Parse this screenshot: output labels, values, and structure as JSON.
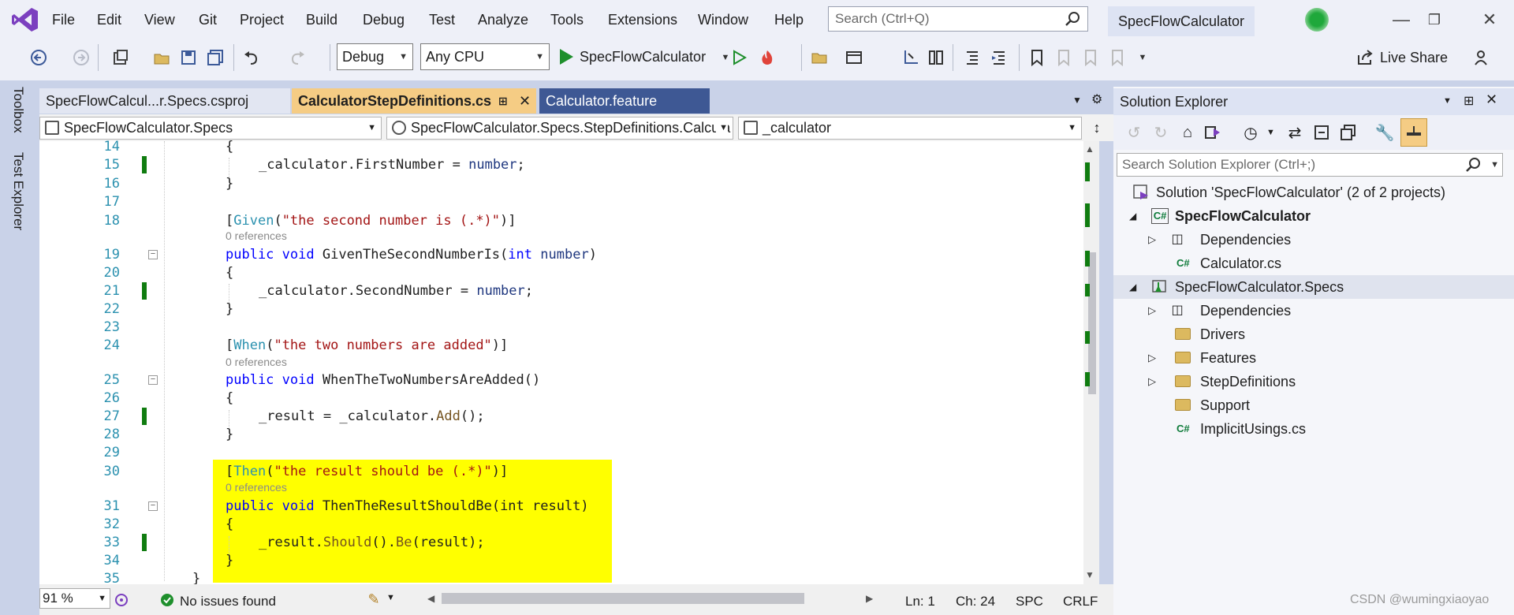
{
  "menu": [
    "File",
    "Edit",
    "View",
    "Git",
    "Project",
    "Build",
    "Debug",
    "Test",
    "Analyze",
    "Tools",
    "Extensions",
    "Window",
    "Help"
  ],
  "search": {
    "placeholder": "Search (Ctrl+Q)"
  },
  "project_title": "SpecFlowCalculator",
  "toolbar": {
    "config": "Debug",
    "platform": "Any CPU",
    "start_label": "SpecFlowCalculator",
    "live_share": "Live Share"
  },
  "left_rail": {
    "toolbox": "Toolbox",
    "test_explorer": "Test Explorer"
  },
  "tabs": [
    {
      "label": "SpecFlowCalcul...r.Specs.csproj"
    },
    {
      "label": "CalculatorStepDefinitions.cs"
    },
    {
      "label": "Calculator.feature"
    }
  ],
  "navbar": {
    "project": "SpecFlowCalculator.Specs",
    "class": "SpecFlowCalculator.Specs.StepDefinitions.Calcula",
    "member": "_calculator"
  },
  "code": {
    "l14": "{",
    "l15a": "_calculator.FirstNumber = ",
    "l15b": "number",
    ";": ";",
    "l18_attr": "Given",
    "l18_str": "\"the second number is (.*)\"",
    "refs": "0 references",
    "l19_name": "GivenTheSecondNumberIs",
    "l19_type": "int",
    "l19_param": "number",
    "l21a": "_calculator.SecondNumber = ",
    "l21b": "number",
    "l24_attr": "When",
    "l24_str": "\"the two numbers are added\"",
    "l25_name": "WhenTheTwoNumbersAreAdded",
    "l27a": "_result = _calculator.",
    "l27b": "Add",
    "l30_attr": "Then",
    "l30_str": "\"the result should be (.*)\"",
    "l31_name": "ThenTheResultShouldBe",
    "l31_param": "int result",
    "l33a": "_result.",
    "l33b": "Should",
    "l33c": "().",
    "l33d": "Be",
    "l33e": "(result);",
    "public": "public",
    "void": "void"
  },
  "line_numbers": [
    "14",
    "15",
    "16",
    "17",
    "18",
    "19",
    "20",
    "21",
    "22",
    "23",
    "24",
    "25",
    "26",
    "27",
    "28",
    "29",
    "30",
    "31",
    "32",
    "33",
    "34",
    "35"
  ],
  "status": {
    "zoom": "91 %",
    "issues": "No issues found",
    "ln": "Ln: 1",
    "ch": "Ch: 24",
    "spc": "SPC",
    "crlf": "CRLF"
  },
  "solution_explorer": {
    "title": "Solution Explorer",
    "search_placeholder": "Search Solution Explorer (Ctrl+;)",
    "items": [
      {
        "label": "Solution 'SpecFlowCalculator' (2 of 2 projects)"
      },
      {
        "label": "SpecFlowCalculator"
      },
      {
        "label": "Dependencies"
      },
      {
        "label": "Calculator.cs"
      },
      {
        "label": "SpecFlowCalculator.Specs"
      },
      {
        "label": "Dependencies"
      },
      {
        "label": "Drivers"
      },
      {
        "label": "Features"
      },
      {
        "label": "StepDefinitions"
      },
      {
        "label": "Support"
      },
      {
        "label": "ImplicitUsings.cs"
      }
    ]
  },
  "watermark": "CSDN @wumingxiaoyao",
  "colors": {
    "accent": "#3e5894",
    "tab_active": "#f5cc84",
    "highlight": "#ffff00",
    "change_marker": "#107c10"
  }
}
